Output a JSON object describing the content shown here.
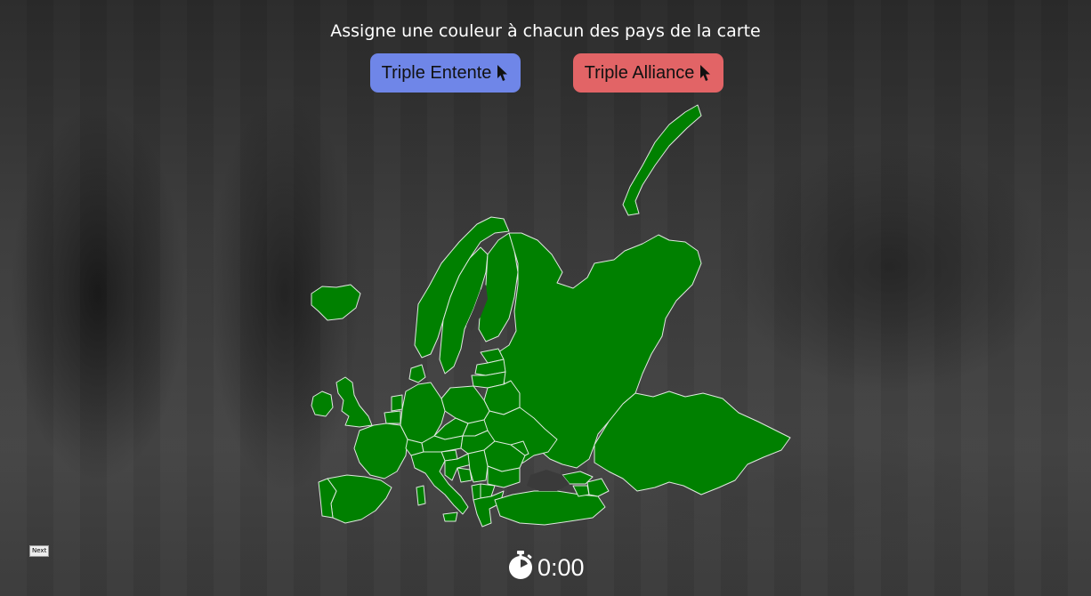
{
  "instruction": "Assigne une couleur à chacun des pays de la carte",
  "buttons": {
    "entente": {
      "label": "Triple Entente",
      "color": "#6f86e8",
      "icon": "cursor-pointer-icon"
    },
    "alliance": {
      "label": "Triple Alliance",
      "color": "#e26466",
      "icon": "cursor-pointer-icon"
    }
  },
  "map": {
    "fill_color": "#008000",
    "border_color": "#dfe8df"
  },
  "next": {
    "label": "Next"
  },
  "timer": {
    "value": "0:00",
    "icon": "stopwatch-icon"
  }
}
